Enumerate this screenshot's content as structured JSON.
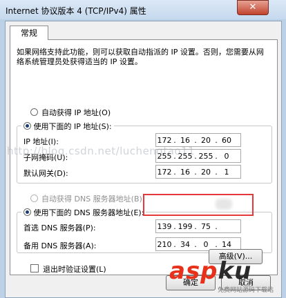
{
  "window": {
    "title": "Internet 协议版本 4 (TCP/IPv4) 属性",
    "close_glyph": "✕"
  },
  "tabs": [
    {
      "label": "常规"
    }
  ],
  "description": "如果网络支持此功能，则可以获取自动指派的 IP 设置。否则，您需要从网络系统管理员处获得适当的 IP 设置。",
  "ip_section": {
    "auto_label": "自动获得 IP 地址(O)",
    "manual_label": "使用下面的 IP 地址(S):",
    "fields": [
      {
        "label": "IP 地址(I):",
        "octets": [
          "172",
          "16",
          "20",
          "60"
        ]
      },
      {
        "label": "子网掩码(U):",
        "octets": [
          "255",
          "255",
          "255",
          "0"
        ]
      },
      {
        "label": "默认网关(D):",
        "octets": [
          "172",
          "16",
          "20",
          "1"
        ]
      }
    ]
  },
  "dns_section": {
    "auto_label": "自动获得 DNS 服务器地址(B)",
    "manual_label": "使用下面的 DNS 服务器地址(E):",
    "fields": [
      {
        "label": "首选 DNS 服务器(P):",
        "octets": [
          "139",
          "199",
          "75",
          ""
        ]
      },
      {
        "label": "备用 DNS 服务器(A):",
        "octets": [
          "210",
          "34",
          "0",
          "14"
        ]
      }
    ]
  },
  "validate_label": "退出时验证设置(L)",
  "advanced_button": "高级(V)...",
  "ok_button": "确定",
  "cancel_button": "取消",
  "watermark": "http://blog.csdn.net/luchengtao11",
  "logo": {
    "main": "asp",
    "accent": "ku",
    "sub": "免费网站源码下载站"
  },
  "colors": {
    "highlight": "#e4383a",
    "logo": "#e8311a"
  }
}
